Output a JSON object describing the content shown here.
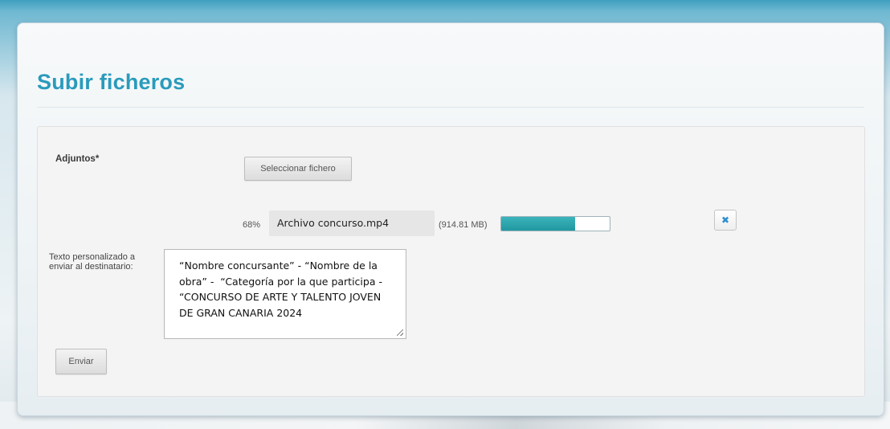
{
  "page": {
    "title": "Subir ficheros"
  },
  "form": {
    "attachments_label": "Adjuntos*",
    "select_file_label": "Seleccionar fichero",
    "upload": {
      "percent_text": "68%",
      "progress_fraction": 0.68,
      "file_name": "Archivo concurso.mp4",
      "file_size_text": "(914.81 MB)",
      "remove_icon": "close-icon"
    },
    "message_label": "Texto personalizado a enviar al destinatario:",
    "message_value": "“Nombre concursante” - “Nombre de la obra” -  “Categoría por la que participa - “CONCURSO DE ARTE Y TALENTO JOVEN DE GRAN CANARIA 2024",
    "submit_label": "Enviar"
  },
  "colors": {
    "title": "#2a9bbc",
    "progress_fill": "#2aa5ad",
    "remove_icon": "#2b8fcf"
  }
}
